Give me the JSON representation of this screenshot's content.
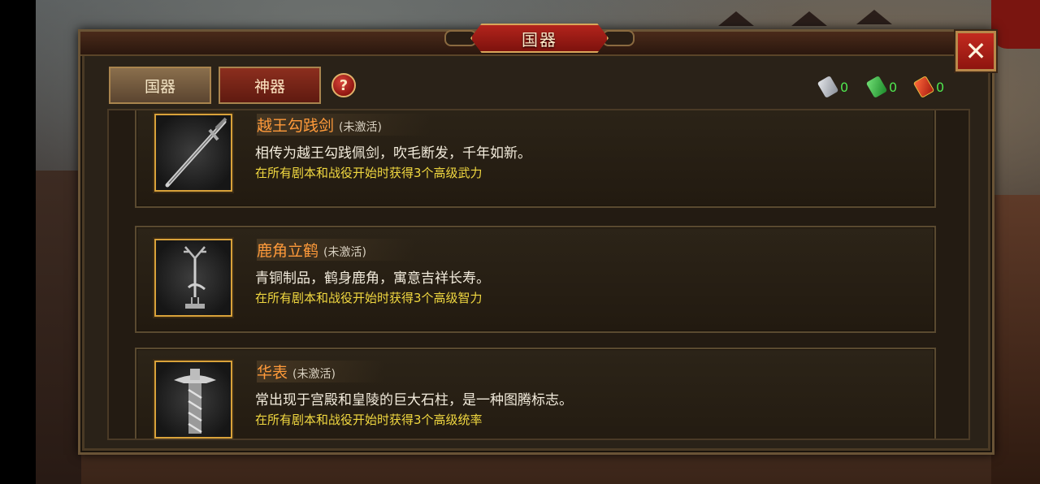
{
  "window": {
    "title": "国器",
    "close_label": "✕"
  },
  "tabs": [
    {
      "label": "国器",
      "active": false
    },
    {
      "label": "神器",
      "active": true
    }
  ],
  "help_label": "?",
  "currencies": [
    {
      "icon": "silver-token-icon",
      "value": "0"
    },
    {
      "icon": "green-token-icon",
      "value": "0"
    },
    {
      "icon": "red-token-icon",
      "value": "0"
    }
  ],
  "items": [
    {
      "name": "越王勾践剑",
      "status": "(未激活)",
      "description": "相传为越王勾践佩剑，吹毛断发，千年如新。",
      "effect": "在所有剧本和战役开始时获得3个高级武力",
      "icon": "sword-icon"
    },
    {
      "name": "鹿角立鹤",
      "status": "(未激活)",
      "description": "青铜制品，鹤身鹿角，寓意吉祥长寿。",
      "effect": "在所有剧本和战役开始时获得3个高级智力",
      "icon": "antler-crane-icon"
    },
    {
      "name": "华表",
      "status": "(未激活)",
      "description": "常出现于宫殿和皇陵的巨大石柱，是一种图腾标志。",
      "effect": "在所有剧本和战役开始时获得3个高级统率",
      "icon": "stone-pillar-icon"
    }
  ],
  "colors": {
    "item_name": "#ff9a3a",
    "effect_text": "#f1d840",
    "currency_value": "#4fe64f",
    "title_plate": "#b3241c"
  }
}
